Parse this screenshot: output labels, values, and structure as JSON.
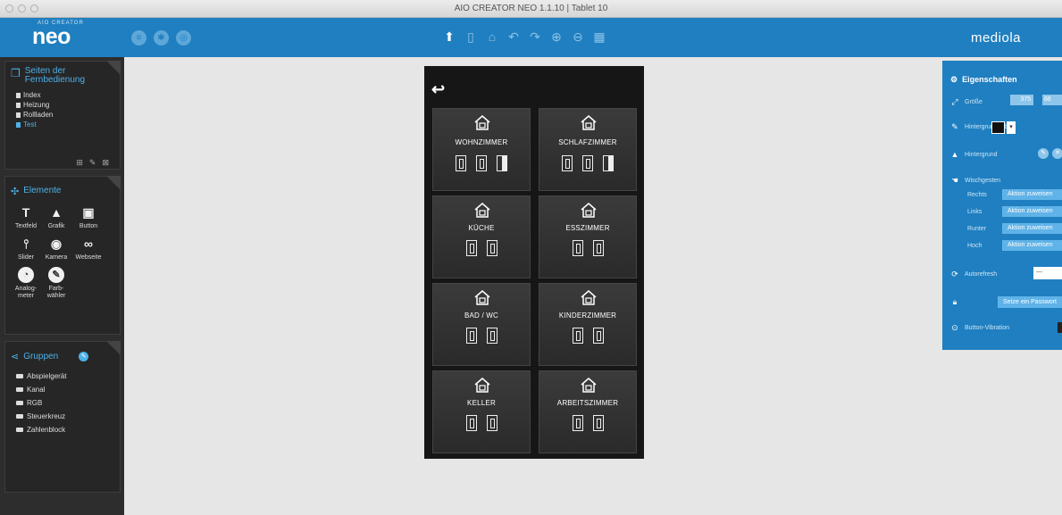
{
  "window": {
    "title": "AIO CREATOR NEO 1.1.10 | Tablet 10"
  },
  "toolbar": {
    "logo_small": "AIO CREATOR",
    "logo_big": "neo",
    "brand": "mediola",
    "left_icons": [
      "menu-icon",
      "settings-icon",
      "globe-icon"
    ],
    "center_icons": [
      "upload-icon",
      "tablet-icon",
      "home-icon",
      "undo-icon",
      "redo-icon",
      "zoom-in-icon",
      "zoom-out-icon",
      "grid-icon"
    ]
  },
  "pages_panel": {
    "title": "Seiten der Fernbedienung",
    "items": [
      {
        "label": "Index",
        "active": false
      },
      {
        "label": "Heizung",
        "active": false
      },
      {
        "label": "Rollladen",
        "active": false
      },
      {
        "label": "Test",
        "active": true
      }
    ]
  },
  "elements_panel": {
    "title": "Elemente",
    "items": [
      {
        "label": "Textfeld",
        "icon": "text-field-icon"
      },
      {
        "label": "Grafik",
        "icon": "image-icon"
      },
      {
        "label": "Button",
        "icon": "button-icon"
      },
      {
        "label": "Slider",
        "icon": "slider-icon"
      },
      {
        "label": "Kamera",
        "icon": "camera-icon"
      },
      {
        "label": "Webseite",
        "icon": "link-icon"
      },
      {
        "label": "Analog-\nmeter",
        "icon": "gauge-icon"
      },
      {
        "label": "Farb-\nwähler",
        "icon": "color-picker-icon"
      }
    ]
  },
  "groups_panel": {
    "title": "Gruppen",
    "items": [
      "Abspielgerät",
      "Kanal",
      "RGB",
      "Steuerkreuz",
      "Zahlenblock"
    ]
  },
  "device": {
    "tiles": [
      {
        "name": "WOHNZIMMER",
        "doors": 3
      },
      {
        "name": "SCHLAFZIMMER",
        "doors": 3
      },
      {
        "name": "KÜCHE",
        "doors": 2
      },
      {
        "name": "ESSZIMMER",
        "doors": 2
      },
      {
        "name": "BAD / WC",
        "doors": 2
      },
      {
        "name": "KINDERZIMMER",
        "doors": 2
      },
      {
        "name": "KELLER",
        "doors": 2
      },
      {
        "name": "ARBEITSZIMMER",
        "doors": 2
      }
    ]
  },
  "properties": {
    "title": "Eigenschaften",
    "size_label": "Größe",
    "size_w": "375",
    "size_h": "66",
    "bg_color_label": "Hintergrundfarbe",
    "bg_color": "#111111",
    "bg_label": "Hintergrund",
    "gestures_label": "Wischgesten",
    "gestures": [
      {
        "label": "Rechts",
        "action": "Aktion zuweisen"
      },
      {
        "label": "Links",
        "action": "Aktion zuweisen"
      },
      {
        "label": "Runter",
        "action": "Aktion zuweisen"
      },
      {
        "label": "Hoch",
        "action": "Aktion zuweisen"
      }
    ],
    "autorefresh_label": "Autorefresh",
    "autorefresh_value": "---",
    "password_button": "Setze ein Passwort",
    "vibration_label": "Button-Vibration"
  }
}
